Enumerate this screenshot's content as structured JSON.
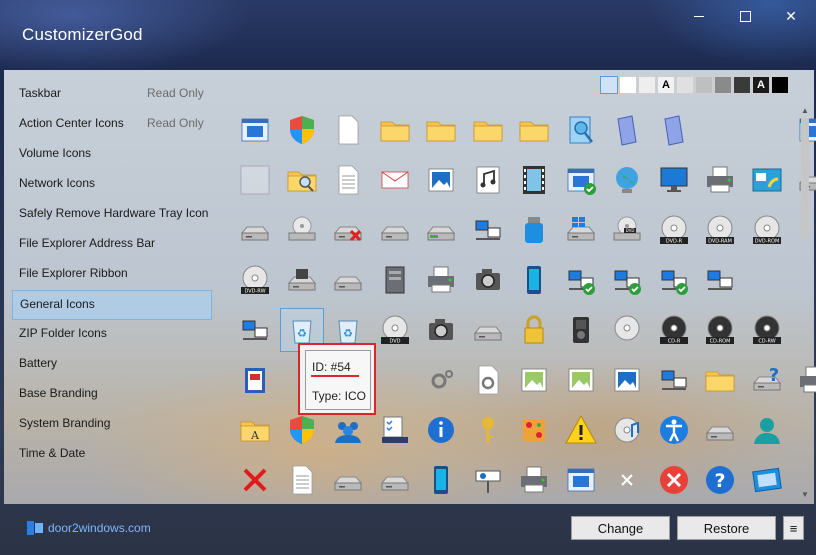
{
  "window": {
    "title": "CustomizerGod"
  },
  "sidebar": {
    "items": [
      {
        "label": "Taskbar",
        "note": "Read Only"
      },
      {
        "label": "Action Center Icons",
        "note": "Read Only"
      },
      {
        "label": "Volume Icons",
        "note": ""
      },
      {
        "label": "Network Icons",
        "note": ""
      },
      {
        "label": "Safely Remove Hardware Tray Icon",
        "note": ""
      },
      {
        "label": "File Explorer Address Bar",
        "note": ""
      },
      {
        "label": "File Explorer Ribbon",
        "note": ""
      },
      {
        "label": "General Icons",
        "note": ""
      },
      {
        "label": "ZIP Folder Icons",
        "note": ""
      },
      {
        "label": "Battery",
        "note": ""
      },
      {
        "label": "Base Branding",
        "note": ""
      },
      {
        "label": "System Branding",
        "note": ""
      },
      {
        "label": "Time & Date",
        "note": ""
      }
    ],
    "selected_index": 7
  },
  "swatches": [
    {
      "bg": "#cfe3f5",
      "text": ""
    },
    {
      "bg": "#ffffff",
      "text": ""
    },
    {
      "bg": "#eeeeee",
      "text": ""
    },
    {
      "bg": "#f2f2f2",
      "text": "A"
    },
    {
      "bg": "#e0e0e0",
      "text": ""
    },
    {
      "bg": "#bfbfbf",
      "text": ""
    },
    {
      "bg": "#8a8a8a",
      "text": ""
    },
    {
      "bg": "#3a3a3a",
      "text": ""
    },
    {
      "bg": "#1a1a1a",
      "text": "A"
    },
    {
      "bg": "#000000",
      "text": ""
    }
  ],
  "icons": [
    [
      "window-icon",
      "shield-icon",
      "document-icon",
      "folder-icon",
      "folder-icon",
      "folder-icon",
      "folder-icon",
      "search-document-icon",
      "doc-group-icon",
      "doc-group-icon",
      "",
      "",
      "window-icon"
    ],
    [
      "blank-icon",
      "search-folder-icon",
      "text-file-icon",
      "mail-icon",
      "image-icon",
      "music-icon",
      "film-icon",
      "check-window-icon",
      "globe-icon",
      "monitor-icon",
      "printer-icon",
      "control-panel-icon",
      "drive-icon"
    ],
    [
      "drive-icon",
      "cd-drive-icon",
      "drive-x-icon",
      "drive-icon",
      "drive-green-icon",
      "network-icon",
      "usb-icon",
      "windows-drive-icon",
      "dvd-drive-icon",
      "dvd-r-icon",
      "dvd-ram-icon",
      "dvd-rom-icon",
      ""
    ],
    [
      "dvd-rw-icon",
      "floppy-icon",
      "drive-icon",
      "server-icon",
      "printer-icon",
      "camera-icon",
      "phone-icon",
      "network-check-icon",
      "network-check-icon",
      "network-check-icon",
      "network-icon",
      "",
      ""
    ],
    [
      "network-icon",
      "recycle-bin-full-icon",
      "recycle-bin-icon",
      "dvd-icon",
      "camera-icon",
      "drive-icon",
      "lock-icon",
      "player-icon",
      "disc-icon",
      "cd-r-icon",
      "cd-rom-icon",
      "cd-rw-icon",
      ""
    ],
    [
      "book-icon",
      "",
      "",
      "",
      "gear-icon",
      "gear-doc-icon",
      "picture-icon",
      "picture-icon",
      "image-icon",
      "network-icon",
      "network-folder-icon",
      "help-drive-icon",
      "printer-icon"
    ],
    [
      "font-folder-icon",
      "shield-icon",
      "users-icon",
      "tasks-icon",
      "info-icon",
      "key-icon",
      "puzzle-icon",
      "warning-icon",
      "music-disc-icon",
      "accessibility-icon",
      "drive-icon",
      "user-icon",
      ""
    ],
    [
      "close-icon",
      "text-file-icon",
      "drive-icon",
      "drive-icon",
      "phone-icon",
      "projector-icon",
      "scanner-icon",
      "window-icon",
      "x-icon",
      "error-icon",
      "help-icon",
      "frame-icon",
      ""
    ]
  ],
  "selected_icon": {
    "row": 4,
    "col": 1
  },
  "tooltip": {
    "id": "ID: #54",
    "type": "Type: ICO"
  },
  "brand": {
    "text": "door2windows.com"
  },
  "buttons": {
    "change": "Change",
    "restore": "Restore",
    "menu": "≡"
  },
  "colors": {
    "accent": "#5c9bd6",
    "highlight": "#d9262b",
    "brand_link": "#7fb6ff"
  }
}
